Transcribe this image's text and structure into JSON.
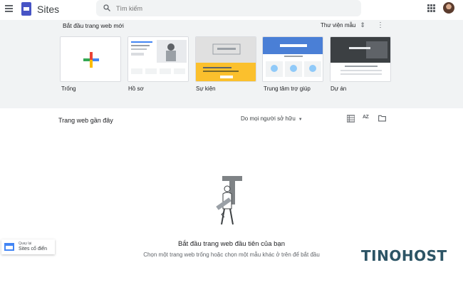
{
  "header": {
    "app_title": "Sites",
    "search_placeholder": "Tìm kiếm"
  },
  "templates": {
    "heading": "Bắt đầu trang web mới",
    "gallery_label": "Thư viện mẫu",
    "items": [
      {
        "label": "Trống"
      },
      {
        "label": "Hồ sơ"
      },
      {
        "label": "Sự kiện"
      },
      {
        "label": "Trung tâm trợ giúp"
      },
      {
        "label": "Dự án"
      }
    ]
  },
  "recent": {
    "title": "Trang web gần đây",
    "owner_filter": "Do mọi người sở hữu",
    "sort_label": "AZ"
  },
  "empty_state": {
    "title": "Bắt đầu trang web đầu tiên của bạn",
    "subtitle": "Chọn một trang web trống hoặc chọn một mẫu khác ở trên để bắt đầu"
  },
  "classic": {
    "line1": "Quay lại",
    "line2": "Sites cổ điển"
  },
  "watermark": "TINOHOST",
  "colors": {
    "brand": "#4754c5",
    "header_bg": "#f1f3f4",
    "watermark": "#2c5465"
  }
}
